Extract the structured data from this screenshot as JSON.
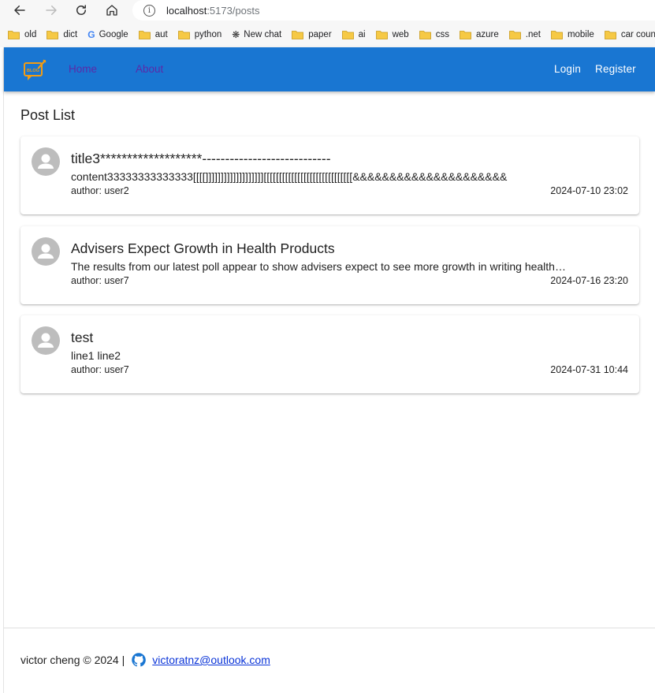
{
  "browser": {
    "url_host": "localhost",
    "url_path": ":5173/posts",
    "bookmarks": [
      {
        "label": "old",
        "icon": "folder-icon"
      },
      {
        "label": "dict",
        "icon": "folder-icon"
      },
      {
        "label": "Google",
        "icon": "google-icon"
      },
      {
        "label": "aut",
        "icon": "folder-icon"
      },
      {
        "label": "python",
        "icon": "folder-icon"
      },
      {
        "label": "New chat",
        "icon": "openai-icon"
      },
      {
        "label": "paper",
        "icon": "folder-icon"
      },
      {
        "label": "ai",
        "icon": "folder-icon"
      },
      {
        "label": "web",
        "icon": "folder-icon"
      },
      {
        "label": "css",
        "icon": "folder-icon"
      },
      {
        "label": "azure",
        "icon": "folder-icon"
      },
      {
        "label": ".net",
        "icon": "folder-icon"
      },
      {
        "label": "mobile",
        "icon": "folder-icon"
      },
      {
        "label": "car countin",
        "icon": "folder-icon"
      }
    ]
  },
  "appbar": {
    "color": "#1976d2",
    "logo_text": "BLOG",
    "nav": {
      "home": "Home",
      "about": "About"
    },
    "auth": {
      "login": "Login",
      "register": "Register"
    }
  },
  "page": {
    "title": "Post List"
  },
  "posts": [
    {
      "title": "title3*******************----------------------------",
      "content": "content33333333333333[[[[]]]]]]]]]]]]]]]]]]][[[[[[[[[[[[[[[[[[[[[[[[[[[[[&&&&&&&&&&&&&&&&&&&&&",
      "author": "author: user2",
      "date": "2024-07-10 23:02"
    },
    {
      "title": "Advisers Expect Growth in Health Products",
      "content": "The results from our latest poll appear to show advisers expect to see more growth in writing health products this year",
      "author": "author: user7",
      "date": "2024-07-16 23:20"
    },
    {
      "title": "test",
      "content": "line1 line2",
      "author": "author: user7",
      "date": "2024-07-31 10:44"
    }
  ],
  "footer": {
    "text": "victor cheng © 2024 |",
    "email": "victoratnz@outlook.com"
  }
}
